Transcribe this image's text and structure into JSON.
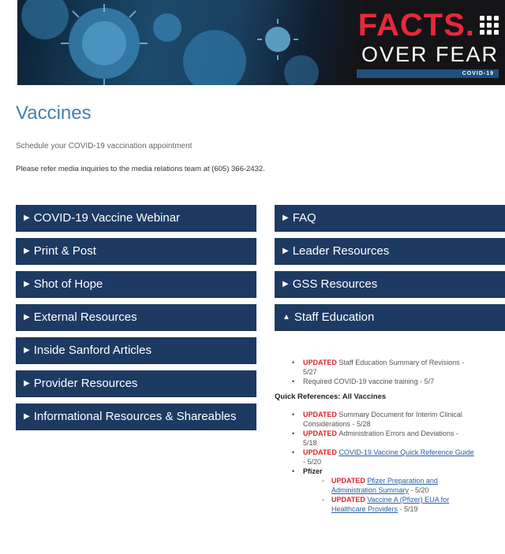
{
  "banner": {
    "facts": "FACTS.",
    "over_fear": "OVER FEAR",
    "covid_tag": "COVID-19"
  },
  "page": {
    "title": "Vaccines",
    "schedule_link": "Schedule your COVID-19 vaccination appointment",
    "media_text": "Please refer media inquiries to the media relations team at (605) 366-2432."
  },
  "left_accordions": [
    "COVID-19 Vaccine Webinar",
    "Print & Post",
    "Shot of Hope",
    "External Resources",
    "Inside Sanford Articles",
    "Provider Resources",
    "Informational Resources & Shareables"
  ],
  "right_accordions": [
    {
      "label": "FAQ",
      "expanded": false
    },
    {
      "label": "Leader Resources",
      "expanded": false
    },
    {
      "label": "GSS Resources",
      "expanded": false
    },
    {
      "label": "Staff Education",
      "expanded": true
    }
  ],
  "staff_education": {
    "items": [
      {
        "tag": "UPDATED",
        "text": "Staff Education Summary of Revisions -",
        "text2": "5/27"
      },
      {
        "text": "Required COVID-19 vaccine training - 5/7"
      }
    ],
    "quick_ref_heading": "Quick References: All Vaccines",
    "quick_refs": [
      {
        "tag": "UPDATED",
        "text": "Summary Document for Interim Clinical",
        "text2": "Considerations - 5/28"
      },
      {
        "tag": "UPDATED",
        "text": "Administration Errors and Deviations -",
        "text2": "5/18"
      },
      {
        "tag": "UPDATED",
        "link": "COVID-19 Vaccine Quick Reference Guide",
        "text2": "- 5/20"
      }
    ],
    "pfizer_label": "Pfizer",
    "pfizer_items": [
      {
        "tag": "UPDATED",
        "link": "Pfizer Preparation and",
        "link2": "Administration Summary",
        "date": " - 5/20"
      },
      {
        "tag": "UPDATED",
        "link": "Vaccine A (Pfizer) EUA for",
        "link2": "Healthcare Providers",
        "date": " - 5/19"
      }
    ]
  },
  "colors": {
    "accordion_bg": "#1d3a63",
    "title_blue": "#4a7faa",
    "updated_red": "#d9262f",
    "link_blue": "#2b5ca3"
  }
}
